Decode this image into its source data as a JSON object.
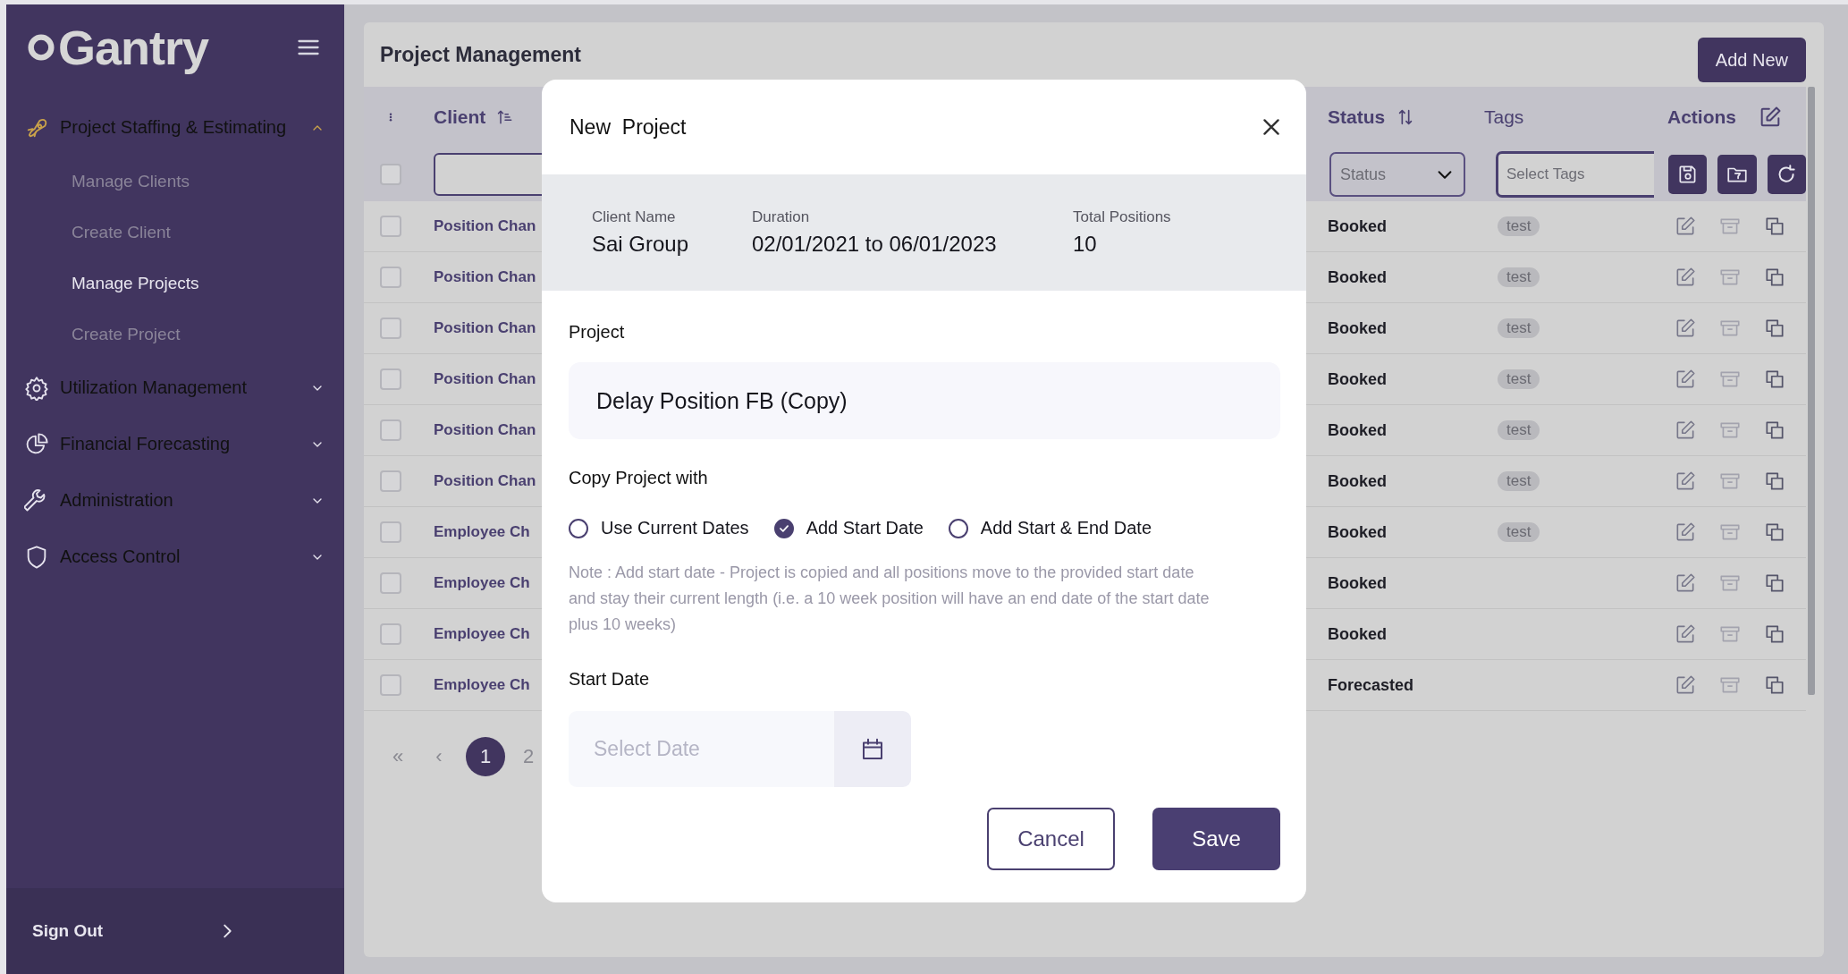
{
  "logo": {
    "text": "Gantry"
  },
  "nav": [
    {
      "label": "Project Staffing & Estimating",
      "expanded": true,
      "children": [
        {
          "label": "Manage Clients",
          "selected": false
        },
        {
          "label": "Create Client",
          "selected": false
        },
        {
          "label": "Manage Projects",
          "selected": true
        },
        {
          "label": "Create Project",
          "selected": false
        }
      ]
    },
    {
      "label": "Utilization Management",
      "expanded": false
    },
    {
      "label": "Financial Forecasting",
      "expanded": false
    },
    {
      "label": "Administration",
      "expanded": false
    },
    {
      "label": "Access Control",
      "expanded": false
    }
  ],
  "sign_out": {
    "label": "Sign Out"
  },
  "page": {
    "title": "Project Management",
    "add_button": "Add New"
  },
  "table": {
    "columns": [
      {
        "label": "Client",
        "kind": "ascending"
      },
      {
        "label": "Status",
        "kind": "sortable"
      },
      {
        "label": "Tags",
        "kind": "plain"
      },
      {
        "label": "Actions",
        "kind": "editable"
      }
    ],
    "select_all": {
      "checked": false
    },
    "filters": {
      "status_placeholder": "Status",
      "tags_placeholder": "Select Tags"
    },
    "rows": [
      {
        "checked": false,
        "client": "Position Chan",
        "status": "Booked",
        "tags": [
          "test"
        ]
      },
      {
        "checked": false,
        "client": "Position Chan",
        "status": "Booked",
        "tags": [
          "test"
        ]
      },
      {
        "checked": false,
        "client": "Position Chan",
        "status": "Booked",
        "tags": [
          "test"
        ]
      },
      {
        "checked": false,
        "client": "Position Chan",
        "status": "Booked",
        "tags": [
          "test"
        ]
      },
      {
        "checked": false,
        "client": "Position Chan",
        "status": "Booked",
        "tags": [
          "test"
        ]
      },
      {
        "checked": false,
        "client": "Position Chan",
        "status": "Booked",
        "tags": [
          "test"
        ]
      },
      {
        "checked": false,
        "client": "Employee Ch",
        "status": "Booked",
        "tags": [
          "test"
        ]
      },
      {
        "checked": false,
        "client": "Employee Ch",
        "status": "Booked",
        "tags": []
      },
      {
        "checked": false,
        "client": "Employee Ch",
        "status": "Booked",
        "tags": []
      },
      {
        "checked": false,
        "client": "Employee Ch",
        "status": "Forecasted",
        "tags": []
      }
    ]
  },
  "pagination": {
    "first": "«",
    "prev": "‹",
    "pages": [
      {
        "label": "1",
        "selected": true
      },
      {
        "label": "2",
        "selected": false
      }
    ]
  },
  "modal": {
    "title": "New  Project",
    "summary": [
      {
        "label": "Client Name",
        "value": "Sai Group"
      },
      {
        "label": "Duration",
        "value": "02/01/2021 to 06/01/2023"
      },
      {
        "label": "Total Positions",
        "value": "10"
      }
    ],
    "project_label": "Project",
    "project_value": "Delay Position FB (Copy)",
    "copy_label": "Copy Project with",
    "options": [
      {
        "label": "Use Current Dates",
        "selected": false
      },
      {
        "label": "Add Start Date",
        "selected": true
      },
      {
        "label": "Add Start & End Date",
        "selected": false
      }
    ],
    "note": "Note : Add start date - Project is copied and all positions move to the provided start date and stay their current length (i.e. a 10 week position will have an end date of the start date plus 10 weeks)",
    "start_date_label": "Start Date",
    "start_date_placeholder": "Select Date",
    "buttons": [
      {
        "label": "Cancel",
        "kind": "secondary"
      },
      {
        "label": "Save",
        "kind": "primary"
      }
    ]
  }
}
